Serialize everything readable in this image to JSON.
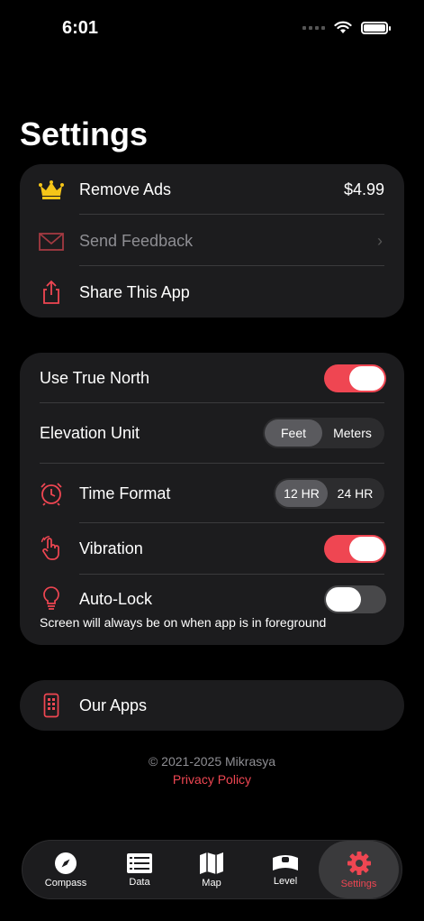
{
  "status_bar": {
    "time": "6:01"
  },
  "page_title": "Settings",
  "card1": {
    "remove_ads": {
      "label": "Remove Ads",
      "price": "$4.99"
    },
    "send_feedback": {
      "label": "Send Feedback"
    },
    "share_app": {
      "label": "Share This App"
    }
  },
  "card2": {
    "true_north": {
      "label": "Use True North",
      "enabled": true
    },
    "elevation_unit": {
      "label": "Elevation Unit",
      "options": [
        "Feet",
        "Meters"
      ],
      "selected": "Feet"
    },
    "time_format": {
      "label": "Time Format",
      "options": [
        "12 HR",
        "24 HR"
      ],
      "selected": "12 HR"
    },
    "vibration": {
      "label": "Vibration",
      "enabled": true
    },
    "auto_lock": {
      "label": "Auto-Lock",
      "enabled": false,
      "note": "Screen will always be on when app is in foreground"
    }
  },
  "card3": {
    "our_apps": {
      "label": "Our Apps"
    }
  },
  "footer": {
    "copyright": "© 2021-2025 Mikrasya",
    "privacy": "Privacy Policy"
  },
  "tabbar": {
    "compass": "Compass",
    "data": "Data",
    "map": "Map",
    "level": "Level",
    "settings": "Settings",
    "active": "Settings"
  },
  "colors": {
    "accent": "#ef4652",
    "card": "#1c1c1e",
    "background": "#000000",
    "crown": "#f5c518"
  }
}
